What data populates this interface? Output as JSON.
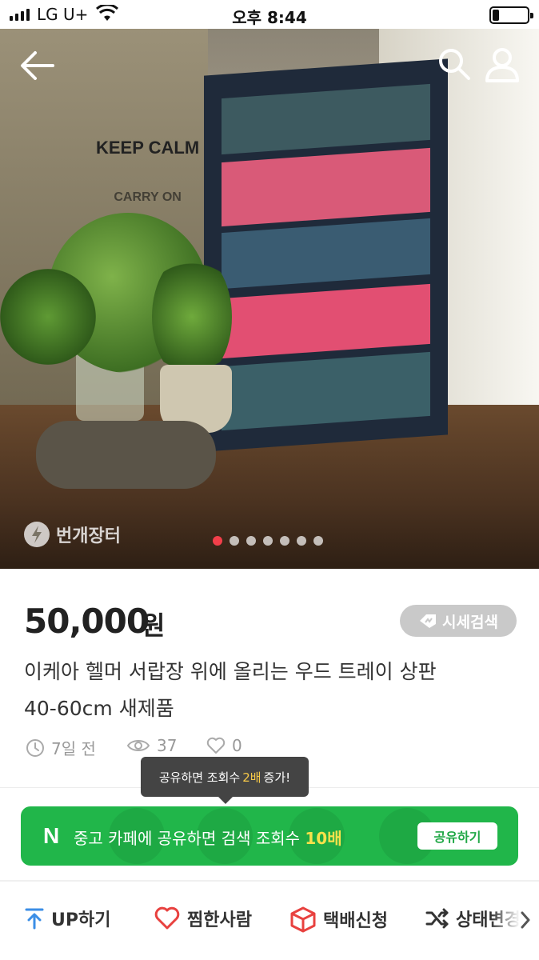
{
  "status_bar": {
    "carrier": "LG U+",
    "time": "오후 8:44",
    "battery_level": 0.2
  },
  "gallery": {
    "watermark": "번개장터",
    "dot_count": 7,
    "active_index": 0,
    "poster_text": "KEEP CALM",
    "poster_text_2": "CARRY ON"
  },
  "product": {
    "price": "50,000",
    "price_unit": "원",
    "market_search_label": "시세검색",
    "title_line1": "이케아 헬머 서랍장 위에 올리는 우드 트레이 상판",
    "title_line2": "40-60cm 새제품",
    "posted": "7일 전",
    "views": "37",
    "likes": "0"
  },
  "tooltip": {
    "prefix": "공유하면 조회수",
    "highlight": "2배",
    "suffix": "증가!"
  },
  "share_banner": {
    "logo": "N",
    "text": "중고 카페에 공유하면 검색 조회수",
    "highlight": "10배",
    "button": "공유하기"
  },
  "actions": [
    {
      "label": "UP하기"
    },
    {
      "label": "찜한사람"
    },
    {
      "label": "택배신청"
    },
    {
      "label": "상태변경"
    }
  ],
  "colors": {
    "accent_red": "#f23f4a",
    "share_green": "#21b64a",
    "highlight_yellow": "#f7c948"
  }
}
